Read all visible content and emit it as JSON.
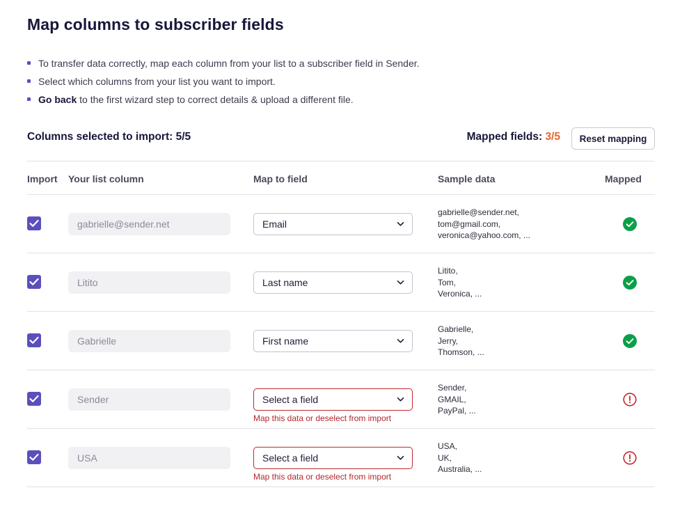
{
  "page": {
    "title": "Map columns to subscriber fields",
    "bullets": [
      {
        "text": "To transfer data correctly, map each column from your list to a subscriber field in Sender."
      },
      {
        "text": "Select which columns from your list you want to import."
      },
      {
        "link": "Go back",
        "text": " to the first wizard step to correct details & upload a different file."
      }
    ]
  },
  "summary": {
    "columns_selected_label": "Columns selected to import: 5/5",
    "mapped_fields_label": "Mapped fields:",
    "mapped_fields_count": "3/5",
    "reset_button": "Reset mapping"
  },
  "table": {
    "headers": {
      "import": "Import",
      "column": "Your list column",
      "map": "Map to field",
      "sample": "Sample data",
      "mapped": "Mapped"
    },
    "rows": [
      {
        "checked": true,
        "column": "gabrielle@sender.net",
        "field": "Email",
        "error": "",
        "sample": [
          "gabrielle@sender.net,",
          "tom@gmail.com,",
          "veronica@yahoo.com, ..."
        ],
        "status": "check-circle-icon"
      },
      {
        "checked": true,
        "column": "Litito",
        "field": "Last name",
        "error": "",
        "sample": [
          "Litito,",
          "Tom,",
          "Veronica, ..."
        ],
        "status": "check-circle-icon"
      },
      {
        "checked": true,
        "column": "Gabrielle",
        "field": "First name",
        "error": "",
        "sample": [
          "Gabrielle,",
          "Jerry,",
          "Thomson, ..."
        ],
        "status": "check-circle-icon"
      },
      {
        "checked": true,
        "column": "Sender",
        "field": "Select a field",
        "error": "Map this data or deselect from import",
        "sample": [
          "Sender,",
          "GMAIL,",
          "PayPal, ..."
        ],
        "status": "warning-circle-icon"
      },
      {
        "checked": true,
        "column": "USA",
        "field": "Select a field",
        "error": "Map this data or deselect from import",
        "sample": [
          "USA,",
          "UK,",
          "Australia, ..."
        ],
        "status": "warning-circle-icon"
      }
    ]
  },
  "colors": {
    "accent": "#5b4fbd",
    "mapped_count": "#e8652a",
    "success": "#0aa04a",
    "error": "#c0282d"
  }
}
